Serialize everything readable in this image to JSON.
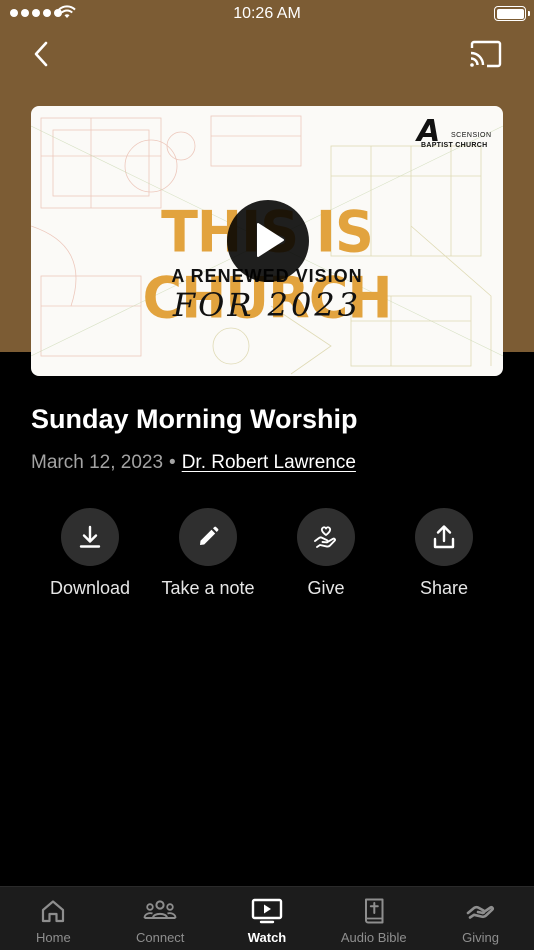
{
  "status_bar": {
    "time": "10:26 AM"
  },
  "header": {
    "back_icon": "chevron-left-icon",
    "cast_icon": "cast-icon"
  },
  "video": {
    "thumbnail_title": "THIS IS CHURCH",
    "thumbnail_subtitle": "A RENEWED VISION",
    "thumbnail_year": "FOR 2023",
    "logo_letter": "A",
    "logo_line1": "SCENSION",
    "logo_line2": "BAPTIST CHURCH",
    "play_icon": "play-icon"
  },
  "sermon": {
    "title": "Sunday Morning Worship",
    "date": "March 12, 2023",
    "separator": "•",
    "speaker": "Dr. Robert Lawrence"
  },
  "actions": [
    {
      "label": "Download",
      "icon": "download-icon"
    },
    {
      "label": "Take a note",
      "icon": "pencil-icon"
    },
    {
      "label": "Give",
      "icon": "heart-hand-icon"
    },
    {
      "label": "Share",
      "icon": "share-icon"
    }
  ],
  "tabs": [
    {
      "label": "Home",
      "icon": "home-icon"
    },
    {
      "label": "Connect",
      "icon": "people-icon"
    },
    {
      "label": "Watch",
      "icon": "tv-play-icon",
      "active": true
    },
    {
      "label": "Audio Bible",
      "icon": "bible-icon"
    },
    {
      "label": "Giving",
      "icon": "giving-hand-icon"
    }
  ],
  "colors": {
    "header_brown": "#7c5c34",
    "title_gold": "#e2a33e",
    "tab_bar": "#1c1c1c",
    "action_circle": "#2f2f2f"
  }
}
